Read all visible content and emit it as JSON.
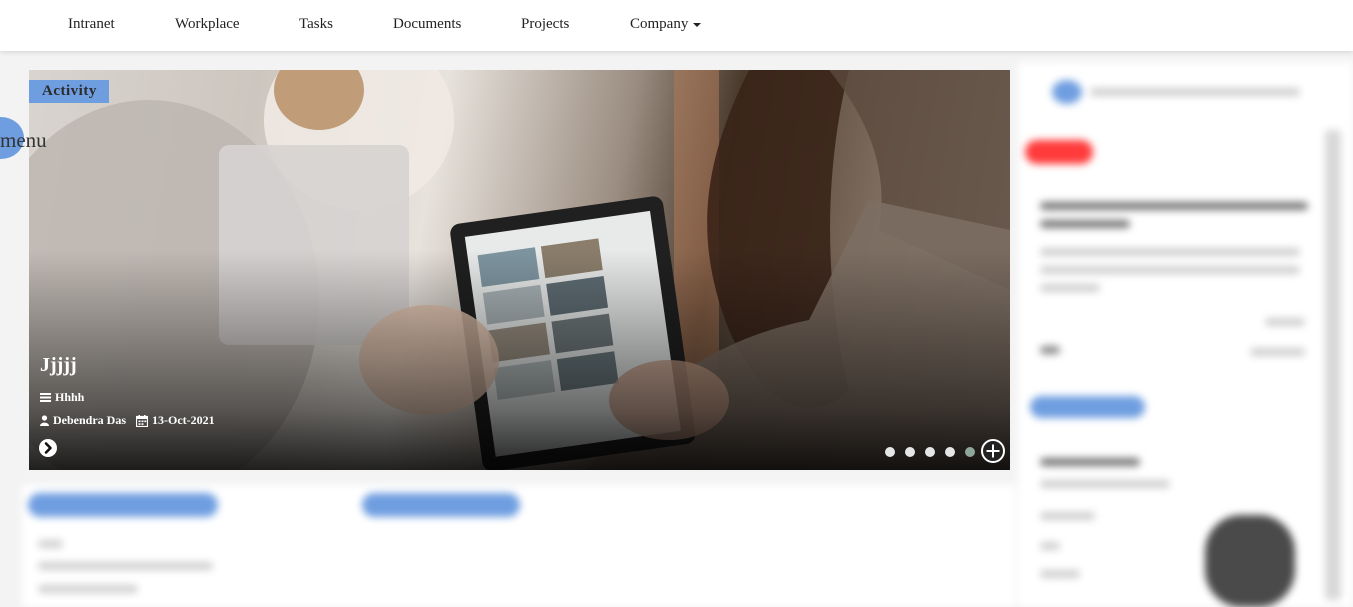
{
  "nav": {
    "items": [
      {
        "label": "Intranet"
      },
      {
        "label": "Workplace"
      },
      {
        "label": "Tasks"
      },
      {
        "label": "Documents"
      },
      {
        "label": "Projects"
      },
      {
        "label": "Company"
      }
    ]
  },
  "activity_badge": "Activity",
  "menu_label": "menu",
  "slide": {
    "title": "Jjjjj",
    "description": "Hhhh",
    "author": "Debendra Das",
    "date": "13-Oct-2021",
    "dot_count": 5,
    "active_dot_index": 4
  },
  "colors": {
    "accent_blue": "#6f9ee0",
    "badge_red": "#ff3b3b",
    "dot_inactive": "#e6e6e6",
    "dot_active": "#8fa69c"
  },
  "icons": {
    "description": "bars-icon",
    "author": "user-icon",
    "date": "calendar-icon",
    "next": "chevron-right-circle-icon",
    "add": "plus-circle-icon",
    "company_dropdown": "caret-down-icon"
  }
}
